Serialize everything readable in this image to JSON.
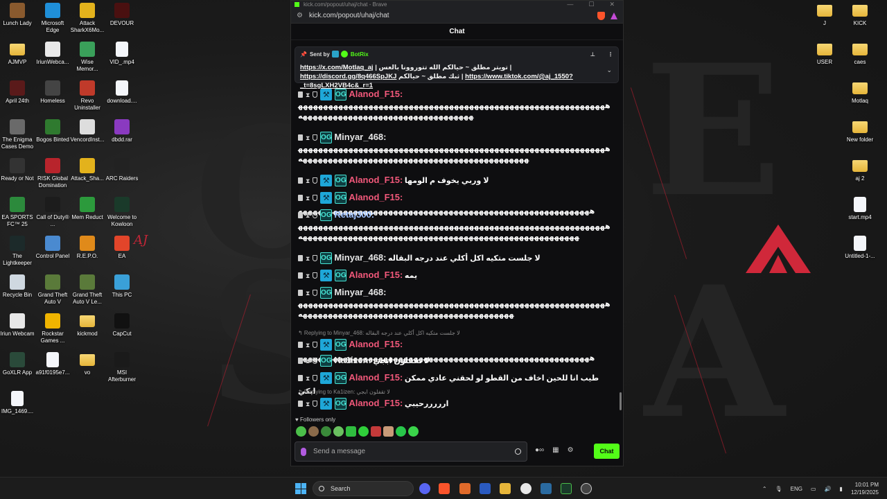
{
  "browser": {
    "title": "kick.com/popout/uhaj/chat - Brave",
    "url": "kick.com/popout/uhaj/chat",
    "window_controls": [
      "—",
      "☐",
      "✕"
    ]
  },
  "chat": {
    "header": "Chat",
    "pinned": {
      "sent_by_label": "Sent by",
      "bot_name": "BotRix",
      "text_start": "ثبك مطلق ~ ",
      "link1": "https://x.com/Motlaq_aj",
      "text_mid1": " | تويتر مطلق ~ حيالكم الله تتوروونا بالعس | ",
      "link2": "https://discord.gg/8q466SpJKJ",
      "text_mid2": " حيالكم | ",
      "link3": "https://www.tiktok.com/@aj_1550?_t=8sgLXH2VB4c&_r=1"
    },
    "messages": [
      {
        "user": "Alanod_F15:",
        "color": "pink",
        "text": "ههههههههههههههههههههههههههههههههههههههههههههههههههههههههههههههههههههههههههههههههههههههههههههههههه"
      },
      {
        "user": "Minyar_468:",
        "color": "white",
        "text": "هههههههههههههههههههههههههههههههههههههههههههههههههههههههههههههههههههههههههههههههههههههههههههههههههههههههههههه"
      },
      {
        "user": "Alanod_F15:",
        "color": "pink",
        "text": "لا وربي يخوف م الومها"
      },
      {
        "user": "Alanod_F15:",
        "color": "pink",
        "text": "ههههههههههههههههههههههههههههههههههههههههههههههههههههههههههه"
      },
      {
        "user": "Retaj300:",
        "color": "blue",
        "text": "هههههههههههههههههههههههههههههههههههههههههههههههههههههههههههههههههههههههههههههههههههههههههههههههههههههههههههههههههههههه"
      },
      {
        "user": "Minyar_468:",
        "color": "white",
        "text": "لا جلست متكيه اكل أكلي عند درجه البقاله"
      },
      {
        "user": "Alanod_F15:",
        "color": "pink",
        "text": "يمه"
      },
      {
        "user": "Minyar_468:",
        "color": "white",
        "text": "ههههههههههههههههههههههههههههههههههههههههههههههههههههههههههههههههههههههههههههههههههههههههههههههههههههههههه"
      },
      {
        "reply": "Replying to Minyar_468: لا جلست متكيه اكل أكلي عند درجه البقاله",
        "user": "Alanod_F15:",
        "color": "pink",
        "text": "ههههههههههههههههههههههههههههههههههههههههههههههههههههههههههه"
      },
      {
        "user": "Ka1izen:",
        "color": "white",
        "text": "لا تقفلون ابجي"
      },
      {
        "user": "Alanod_F15:",
        "color": "pink",
        "text": "طيب انا للحين اخاف من القطو لو لحقني عادي ممكن ابكي"
      },
      {
        "reply": "Replying to Ka1izen: لا تقفلون ابجي",
        "user": "Alanod_F15:",
        "color": "pink",
        "text": "ارررررحيبي"
      }
    ],
    "followers_only": "Followers only",
    "input_placeholder": "Send a message",
    "send_label": "Chat"
  },
  "desktop_icons_left": [
    {
      "label": "Lunch Lady",
      "icon": "game-icon",
      "color": "#8a5a2e"
    },
    {
      "label": "Microsoft Edge",
      "icon": "edge-icon",
      "color": "#1f8fd8"
    },
    {
      "label": "Attack SharkX6Mo...",
      "icon": "mouse-icon",
      "color": "#e3b21c"
    },
    {
      "label": "DEVOUR",
      "icon": "game-icon",
      "color": "#4a1010"
    },
    {
      "label": "AJMVP",
      "icon": "folder-icon",
      "color": "#f0c84a"
    },
    {
      "label": "IriunWebca...",
      "icon": "webcam-icon",
      "color": "#e8e8e8"
    },
    {
      "label": "Wise Memor...",
      "icon": "app-icon",
      "color": "#3aa05a"
    },
    {
      "label": "VID_.mp4",
      "icon": "file-icon",
      "color": "#f4f6fa"
    },
    {
      "label": "April 24th",
      "icon": "game-icon",
      "color": "#5a1a1a"
    },
    {
      "label": "Homeless",
      "icon": "game-icon",
      "color": "#444444"
    },
    {
      "label": "Revo Uninstaller",
      "icon": "app-icon",
      "color": "#c03a2a"
    },
    {
      "label": "download....",
      "icon": "file-icon",
      "color": "#f4f6fa"
    },
    {
      "label": "The Enigma Cases Demo",
      "icon": "game-icon",
      "color": "#6a6a6a"
    },
    {
      "label": "Bogos Binted",
      "icon": "game-icon",
      "color": "#2f7a2f"
    },
    {
      "label": "VencordInst...",
      "icon": "app-icon",
      "color": "#dddddd"
    },
    {
      "label": "dbdd.rar",
      "icon": "archive-icon",
      "color": "#8a3ac0"
    },
    {
      "label": "Ready or Not",
      "icon": "game-icon",
      "color": "#333333"
    },
    {
      "label": "RISK Global Domination",
      "icon": "game-icon",
      "color": "#b8242c"
    },
    {
      "label": "Attack_Sha...",
      "icon": "mouse-icon",
      "color": "#e3b21c"
    },
    {
      "label": "ARC Raiders",
      "icon": "game-icon",
      "color": "#222222"
    },
    {
      "label": "EA SPORTS FC™ 25",
      "icon": "game-icon",
      "color": "#2c8a3c"
    },
    {
      "label": "Call of Duty® ...",
      "icon": "game-icon",
      "color": "#1c1c1c"
    },
    {
      "label": "Mem Reduct",
      "icon": "app-icon",
      "color": "#2c9a3c"
    },
    {
      "label": "Welcome to Kowloon",
      "icon": "game-icon",
      "color": "#1a3a2a"
    },
    {
      "label": "The Lightkeeper",
      "icon": "game-icon",
      "color": "#1c2a2a"
    },
    {
      "label": "Control Panel",
      "icon": "control-panel-icon",
      "color": "#4a8ad0"
    },
    {
      "label": "R.E.P.O.",
      "icon": "game-icon",
      "color": "#e08a1a"
    },
    {
      "label": "EA",
      "icon": "ea-icon",
      "color": "#e2452a"
    },
    {
      "label": "Recycle Bin",
      "icon": "recycle-bin-icon",
      "color": "#cfd8e0"
    },
    {
      "label": "Grand Theft Auto V",
      "icon": "game-icon",
      "color": "#5a7a3a"
    },
    {
      "label": "Grand Theft Auto V Le...",
      "icon": "game-icon",
      "color": "#5a7a3a"
    },
    {
      "label": "This PC",
      "icon": "computer-icon",
      "color": "#3aa0d8"
    },
    {
      "label": "Iriun Webcam",
      "icon": "webcam-icon",
      "color": "#e8e8e8"
    },
    {
      "label": "Rockstar Games ...",
      "icon": "rockstar-icon",
      "color": "#f0b400"
    },
    {
      "label": "kickmod",
      "icon": "folder-icon",
      "color": "#f0c84a"
    },
    {
      "label": "CapCut",
      "icon": "capcut-icon",
      "color": "#111111"
    },
    {
      "label": "GoXLR App",
      "icon": "app-icon",
      "color": "#2a4a3a"
    },
    {
      "label": "a91f0195e7...",
      "icon": "file-icon",
      "color": "#f4f6fa"
    },
    {
      "label": "vo",
      "icon": "folder-icon",
      "color": "#f0c84a"
    },
    {
      "label": "MSI Afterburner",
      "icon": "app-icon",
      "color": "#1a1a1a"
    },
    {
      "label": "IMG_1469....",
      "icon": "file-icon",
      "color": "#f4f6fa"
    }
  ],
  "desktop_icons_right": [
    {
      "label": "J",
      "icon": "folder-icon"
    },
    {
      "label": "KICK",
      "icon": "folder-icon"
    },
    {
      "label": "USER",
      "icon": "folder-icon"
    },
    {
      "label": "caes",
      "icon": "folder-icon"
    },
    {
      "label": "Motlaq",
      "icon": "folder-icon"
    },
    {
      "label": "New folder",
      "icon": "folder-icon"
    },
    {
      "label": "aj 2",
      "icon": "folder-icon"
    },
    {
      "label": "start.mp4",
      "icon": "file-icon"
    },
    {
      "label": "Untitled-1-...",
      "icon": "file-icon"
    }
  ],
  "wallpaper": {
    "signature": "AJ"
  },
  "taskbar": {
    "search_label": "Search",
    "lang": "ENG",
    "time": "10:01 PM",
    "date": "12/19/2025"
  }
}
